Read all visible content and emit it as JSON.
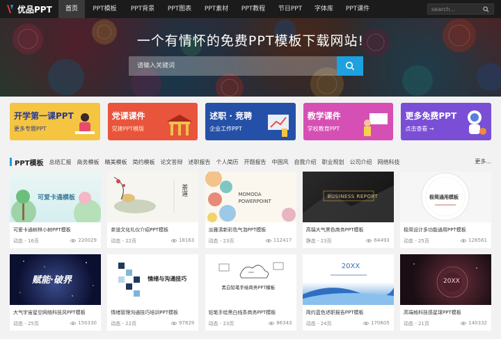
{
  "logo": {
    "text": "优品PPT"
  },
  "nav": {
    "items": [
      "首页",
      "PPT模板",
      "PPT背景",
      "PPT图表",
      "PPT素材",
      "PPT教程",
      "节日PPT",
      "字体库",
      "PPT课件"
    ],
    "search_placeholder": "search..."
  },
  "hero": {
    "title": "一个有情怀的免费PPT模板下载网站!",
    "search_placeholder": "请输入关键词"
  },
  "banners": [
    {
      "title": "开学第一课PPT",
      "sub": "更多专题PPT",
      "bg": "#f5c542",
      "title_color": "#2a3a8a",
      "sub_color": "#2a3a8a"
    },
    {
      "title": "党课课件",
      "sub": "党建PPT模版",
      "bg": "#e8543c",
      "title_color": "#ffffff",
      "sub_color": "#ffe9c9"
    },
    {
      "title": "述职 · 竞聘",
      "sub": "企业工作PPT",
      "bg": "#2450a8",
      "title_color": "#ffffff",
      "sub_color": "#ffffff"
    },
    {
      "title": "教学课件",
      "sub": "学校教育PPT",
      "bg": "#d64fb4",
      "title_color": "#ffffff",
      "sub_color": "#ffffff"
    },
    {
      "title": "更多免费PPT",
      "sub": "点击查看 →",
      "bg": "#7a4fd6",
      "title_color": "#ffffff",
      "sub_color": "#ffffff"
    }
  ],
  "categories": {
    "title": "PPT模板",
    "items": [
      "总结汇报",
      "商务模板",
      "精美模板",
      "简约模板",
      "论文答辩",
      "述职报告",
      "个人简历",
      "开题报告",
      "中国风",
      "自我介绍",
      "职业规划",
      "公司介绍",
      "网络科技"
    ],
    "more": "更多..."
  },
  "cards": [
    {
      "title": "可爱卡通树林小树PPT模板",
      "meta": "动态 - 16页",
      "views": "220029",
      "thumb_text": "可爱卡通模板"
    },
    {
      "title": "茶道文化礼仪介绍PPT模板",
      "meta": "动态 - 22页",
      "views": "18163",
      "thumb_text": "茶道"
    },
    {
      "title": "淡雅清新彩色气泡PPT模板",
      "meta": "动态 - 23页",
      "views": "112417",
      "thumb_text": "MOMODA POWERPOINT"
    },
    {
      "title": "高端大气黑色商务PPT模板",
      "meta": "静态 - 23页",
      "views": "64493",
      "thumb_text": "BUSINESS REPORT"
    },
    {
      "title": "极简设计多功能通用PPT模板",
      "meta": "动态 - 25页",
      "views": "126561",
      "thumb_text": "极简通用模板"
    },
    {
      "title": "大气宇宙星空网络科技风PPT模板",
      "meta": "动态 - 25页",
      "views": "150330",
      "thumb_text": "赋能·破界"
    },
    {
      "title": "情绪管理沟通技巧培训PPT模板",
      "meta": "动态 - 22页",
      "views": "97829",
      "thumb_text": "情绪与沟通技巧"
    },
    {
      "title": "铅笔手绘黑白线条商务PPT模板",
      "meta": "动态 - 23页",
      "views": "86343",
      "thumb_text": "黑白铅笔手绘商务PPT模板"
    },
    {
      "title": "简约蓝色述职报告PPT模板",
      "meta": "动态 - 24页",
      "views": "170605",
      "thumb_text": "20XX"
    },
    {
      "title": "高端格科技感星球PPT模板",
      "meta": "动态 - 21页",
      "views": "140332",
      "thumb_text": "20XX"
    }
  ]
}
